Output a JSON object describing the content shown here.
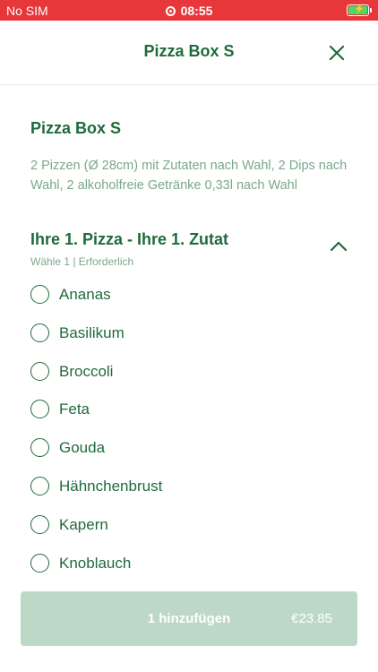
{
  "status_bar": {
    "carrier": "No SIM",
    "time": "08:55",
    "battery_color": "#4cd964",
    "background_color": "#e8373a"
  },
  "navbar": {
    "title": "Pizza Box S",
    "close_icon": "close-icon"
  },
  "product": {
    "title": "Pizza Box S",
    "description": "2 Pizzen (Ø 28cm) mit Zutaten nach Wahl, 2 Dips nach Wahl, 2 alkoholfreie Getränke 0,33l nach Wahl"
  },
  "option_group": {
    "title": "Ihre 1. Pizza - Ihre 1. Zutat",
    "subtitle": "Wähle 1  |  Erforderlich",
    "expanded_icon": "chevron-up-icon",
    "options": [
      {
        "label": "Ananas",
        "selected": false
      },
      {
        "label": "Basilikum",
        "selected": false
      },
      {
        "label": "Broccoli",
        "selected": false
      },
      {
        "label": "Feta",
        "selected": false
      },
      {
        "label": "Gouda",
        "selected": false
      },
      {
        "label": "Hähnchenbrust",
        "selected": false
      },
      {
        "label": "Kapern",
        "selected": false
      },
      {
        "label": "Knoblauch",
        "selected": false
      }
    ]
  },
  "add_button": {
    "label": "1 hinzufügen",
    "price": "€23.85",
    "state": "disabled"
  },
  "colors": {
    "brand_green": "#1f6b3a",
    "muted_green": "#7aa88a",
    "button_disabled": "#bdd8c6"
  }
}
